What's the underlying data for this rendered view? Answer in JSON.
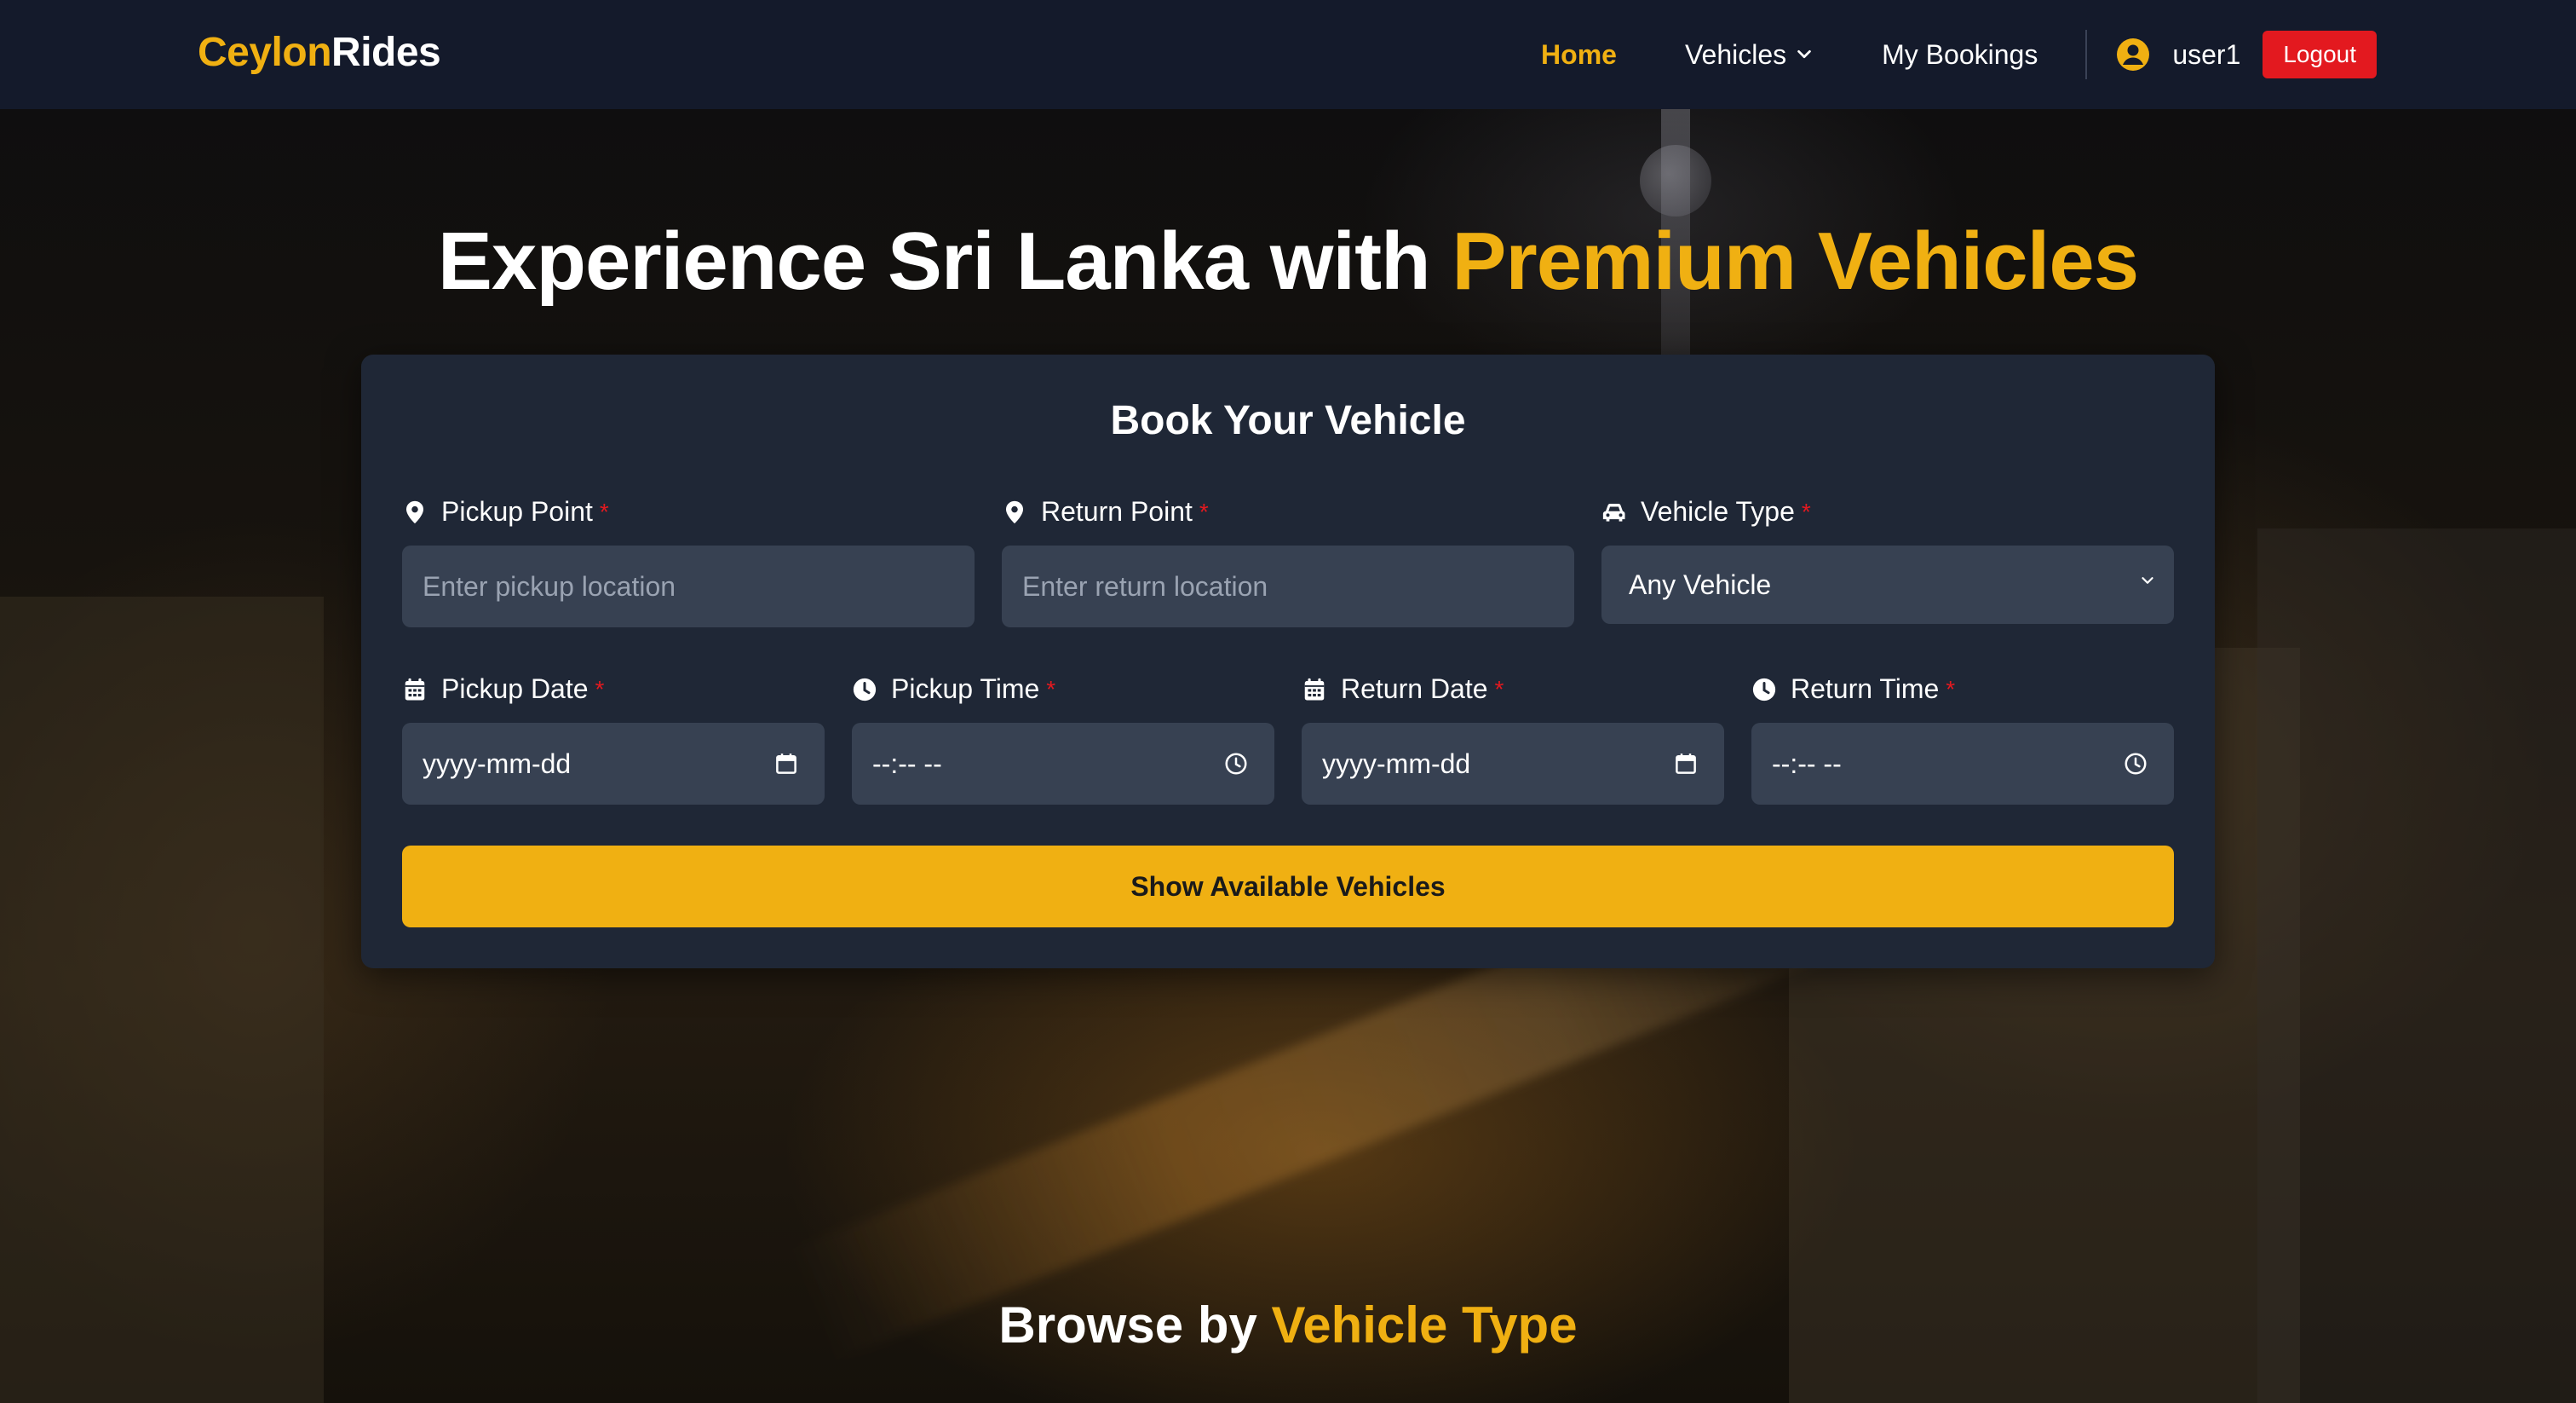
{
  "brand": {
    "part1": "Ceylon",
    "part2": "Rides"
  },
  "nav": {
    "home": "Home",
    "vehicles": "Vehicles",
    "my_bookings": "My Bookings",
    "username": "user1",
    "logout": "Logout"
  },
  "hero": {
    "title_main": "Experience Sri Lanka with ",
    "title_accent": "Premium Vehicles"
  },
  "booking": {
    "title": "Book Your Vehicle",
    "pickup_point": {
      "label": "Pickup Point",
      "placeholder": "Enter pickup location",
      "required": "*"
    },
    "return_point": {
      "label": "Return Point",
      "placeholder": "Enter return location",
      "required": "*"
    },
    "vehicle_type": {
      "label": "Vehicle Type",
      "value": "Any Vehicle",
      "required": "*"
    },
    "pickup_date": {
      "label": "Pickup Date",
      "value": "yyyy-mm-dd",
      "required": "*"
    },
    "pickup_time": {
      "label": "Pickup Time",
      "value": "--:-- --",
      "required": "*"
    },
    "return_date": {
      "label": "Return Date",
      "value": "yyyy-mm-dd",
      "required": "*"
    },
    "return_time": {
      "label": "Return Time",
      "value": "--:-- --",
      "required": "*"
    },
    "submit": "Show Available Vehicles"
  },
  "browse": {
    "title_main": "Browse by ",
    "title_accent": "Vehicle Type"
  },
  "colors": {
    "accent": "#f0b012",
    "navbar": "#141a2b",
    "card": "#1f2736",
    "field": "#374152",
    "danger": "#e3191f"
  },
  "icons": [
    "map-pin-icon",
    "car-icon",
    "calendar-icon",
    "clock-icon",
    "chevron-down-icon",
    "user-circle-icon"
  ]
}
